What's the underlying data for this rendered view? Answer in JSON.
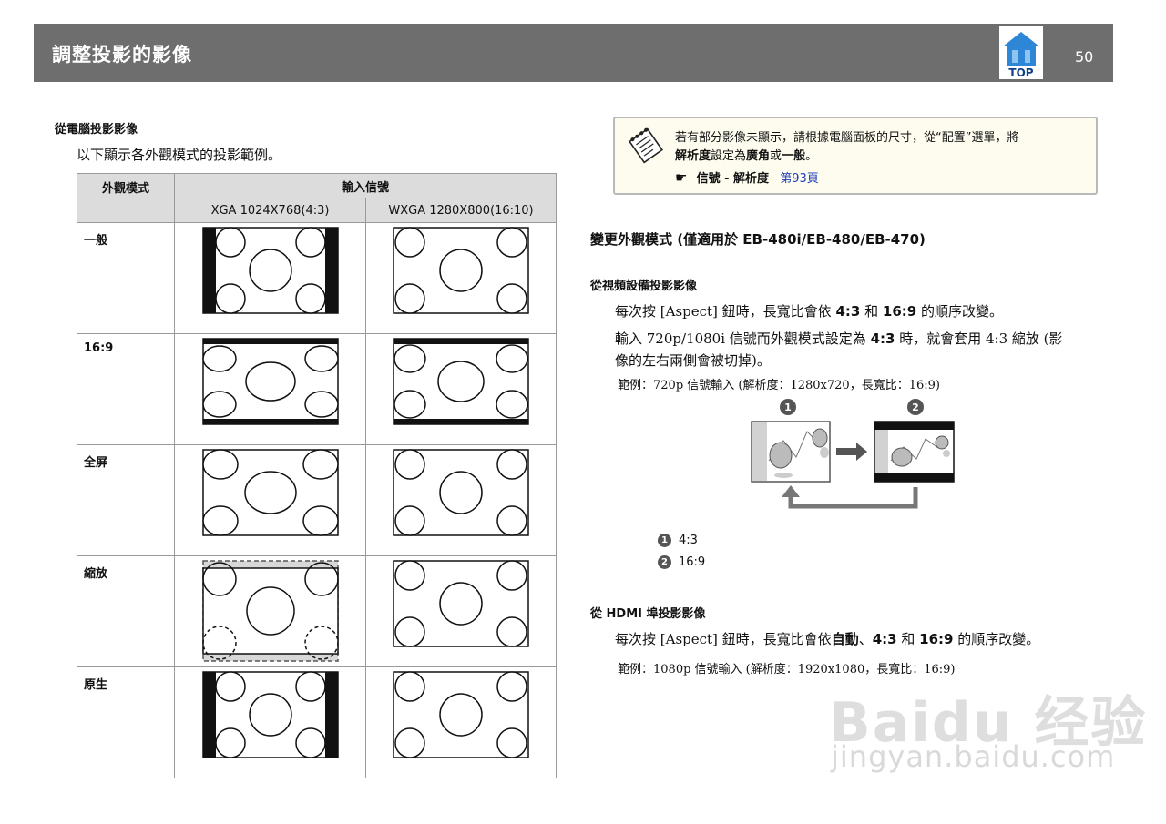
{
  "header": {
    "title": "調整投影的影像",
    "top_label": "TOP",
    "page_number": "50"
  },
  "left": {
    "section_title": "從電腦投影影像",
    "intro": "以下顯示各外觀模式的投影範例。",
    "table": {
      "col_mode": "外觀模式",
      "col_signal": "輸入信號",
      "col_xga": "XGA 1024X768(4:3)",
      "col_wxga": "WXGA 1280X800(16:10)",
      "rows": [
        {
          "mode": "一般"
        },
        {
          "mode": "16:9"
        },
        {
          "mode": "全屏"
        },
        {
          "mode": "縮放"
        },
        {
          "mode": "原生"
        }
      ]
    }
  },
  "note": {
    "line1": "若有部分影像未顯示，請根據電腦面板的尺寸，從“配置”選單，將",
    "line2_bold1": "解析度",
    "line2_mid": "設定為",
    "line2_bold2": "廣角",
    "line2_or": "或",
    "line2_bold3": "一般",
    "line2_end": "。",
    "ref_path": "信號 - 解析度",
    "ref_link": "第93頁"
  },
  "right": {
    "heading": "變更外觀模式 (僅適用於 EB-480i/EB-480/EB-470)",
    "video_title": "從視頻設備投影影像",
    "video_p1_a": "每次按 [Aspect] 鈕時，長寬比會依",
    "video_p1_b1": "4:3",
    "video_p1_and": "和",
    "video_p1_b2": "16:9",
    "video_p1_c": "的順序改變。",
    "video_p2_a": "輸入 720p/1080i 信號而外觀模式設定為",
    "video_p2_b": "4:3",
    "video_p2_c": "時，就會套用 4:3 縮放 (影",
    "video_p2_d": "像的左右兩側會被切掉)。",
    "video_example": "範例：720p 信號輸入 (解析度：1280x720，長寬比：16:9)",
    "legend": [
      {
        "num": "1",
        "label": "4:3"
      },
      {
        "num": "2",
        "label": "16:9"
      }
    ],
    "hdmi_title": "從 HDMI 埠投影影像",
    "hdmi_p1_a": "每次按 [Aspect] 鈕時，長寬比會依",
    "hdmi_p1_b1": "自動",
    "hdmi_p1_sep": "、",
    "hdmi_p1_b2": "4:3",
    "hdmi_p1_and": "和",
    "hdmi_p1_b3": "16:9",
    "hdmi_p1_c": "的順序改變。",
    "hdmi_example": "範例：1080p 信號輸入 (解析度：1920x1080，長寬比：16:9)"
  },
  "watermark": {
    "line1": "Baidu 经验",
    "line2": "jingyan.baidu.com"
  }
}
